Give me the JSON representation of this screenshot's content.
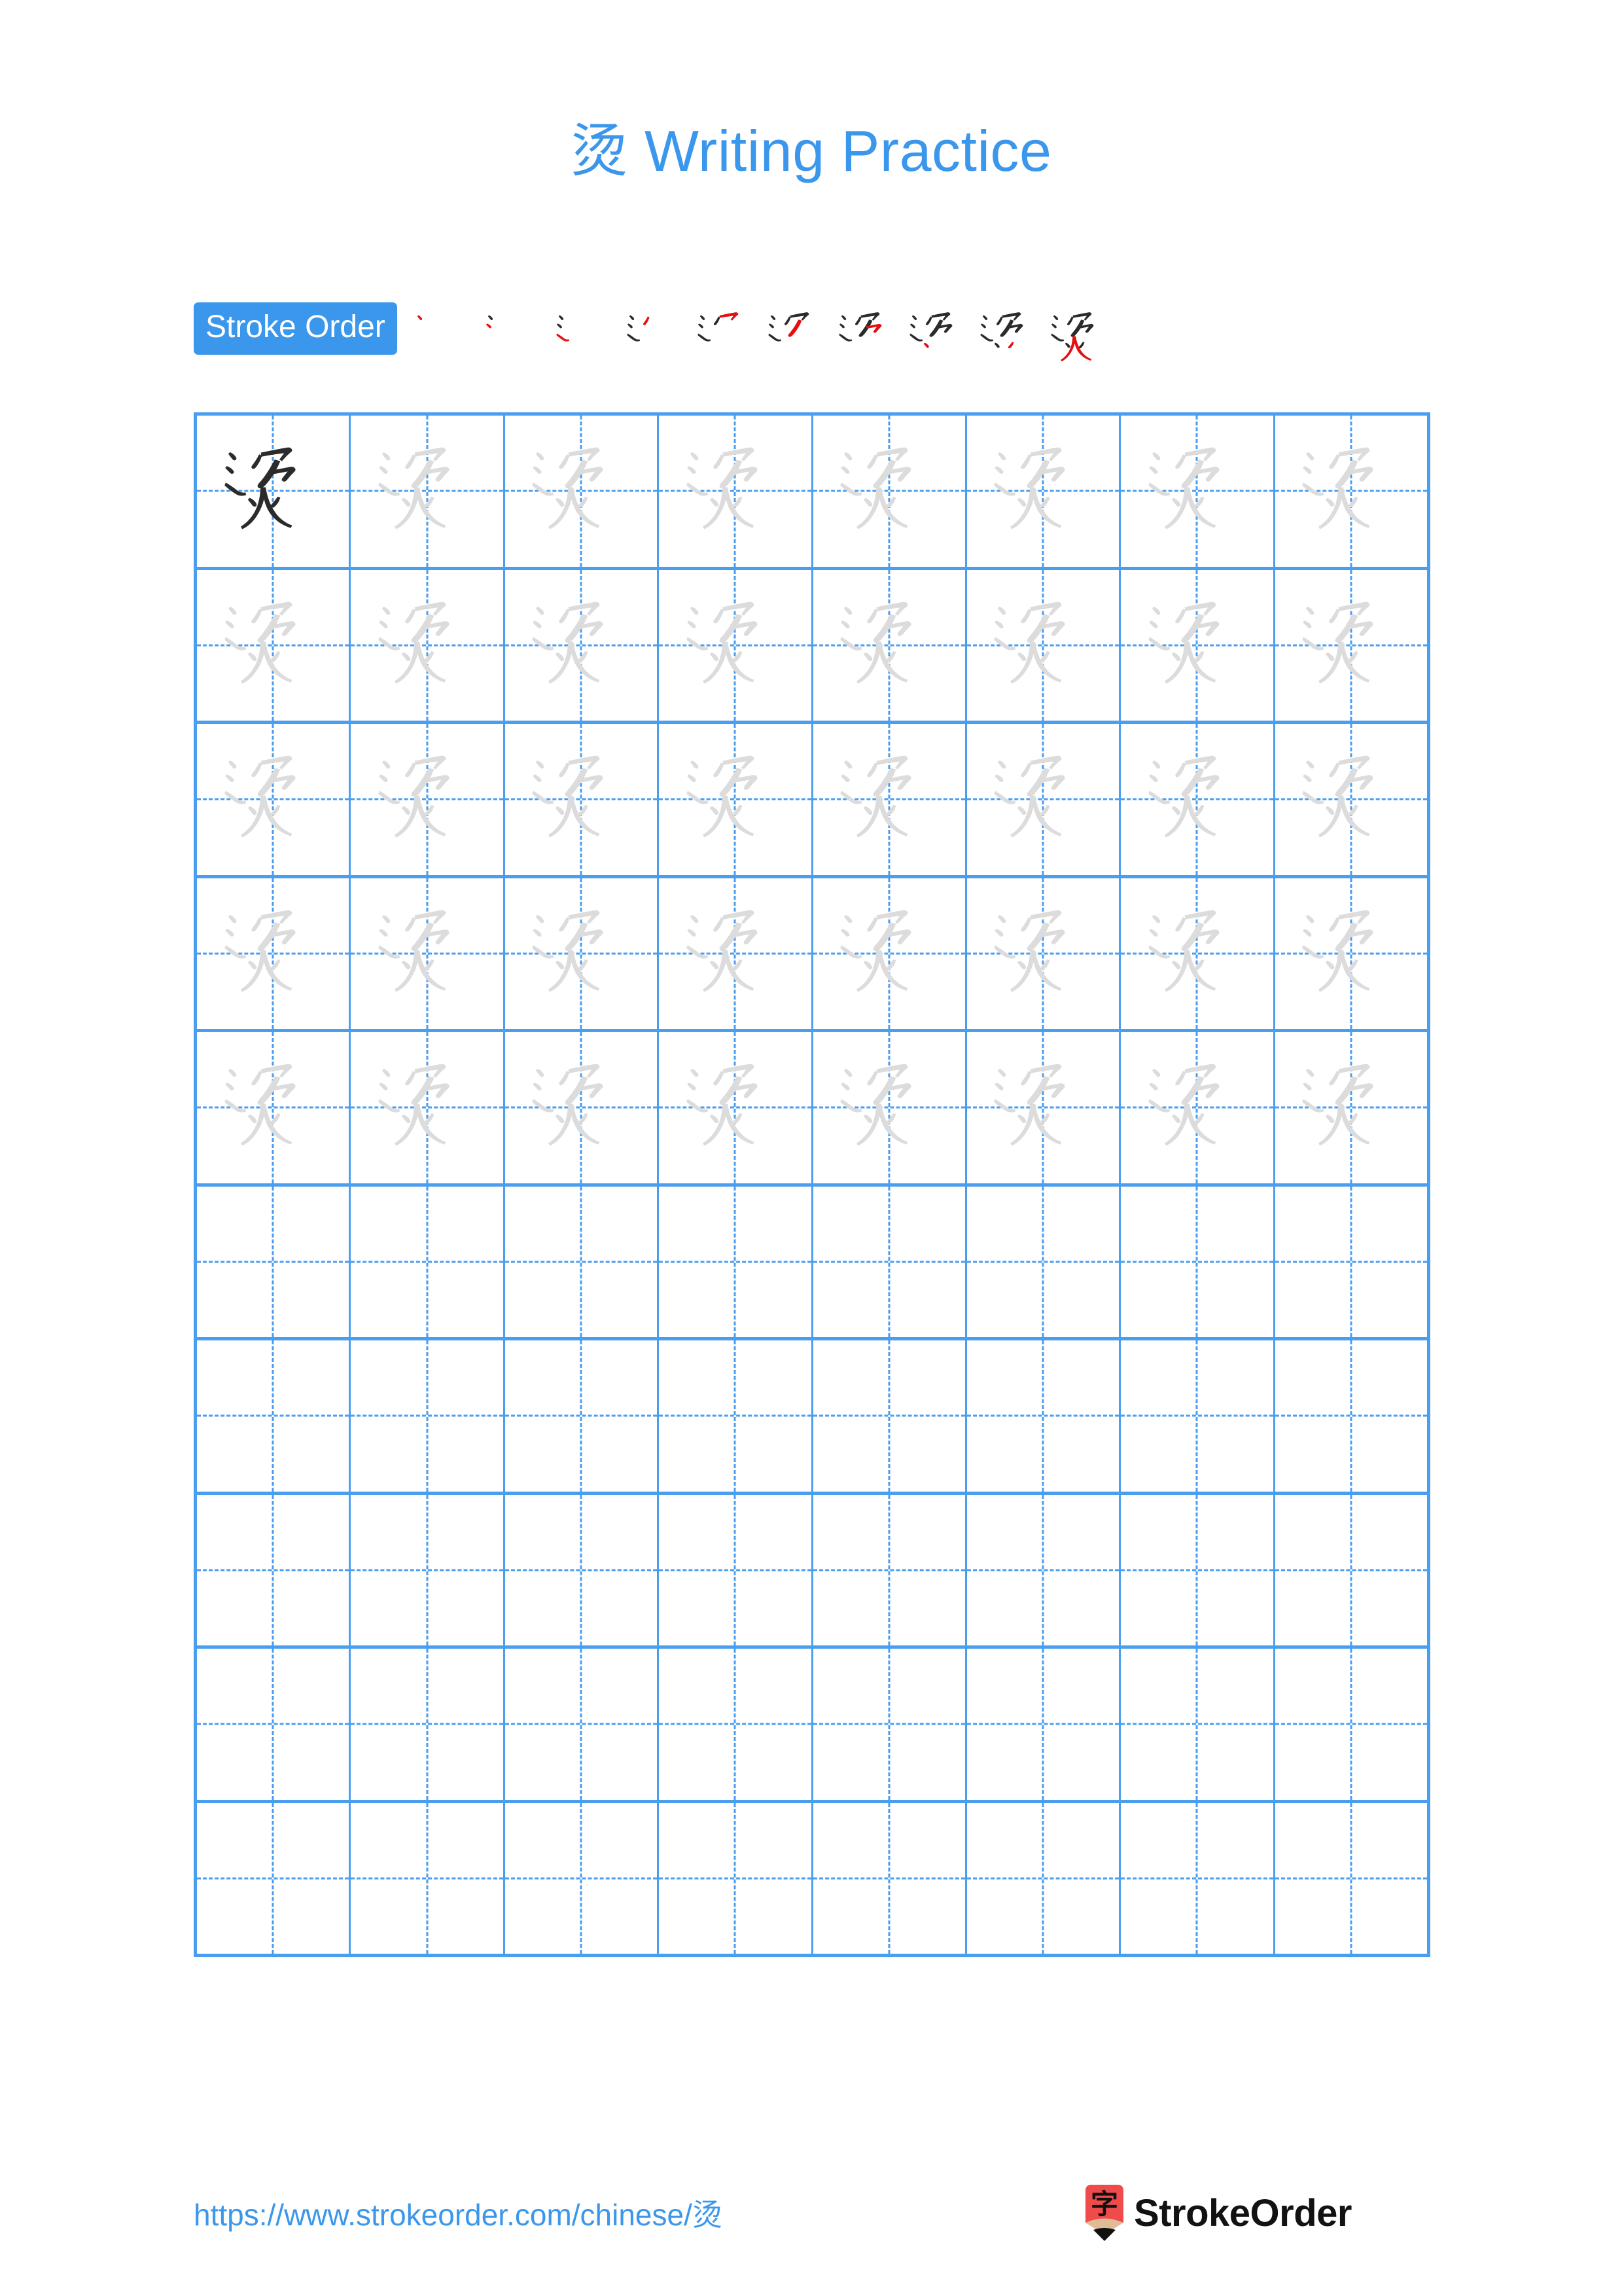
{
  "character": "烫",
  "title": {
    "character": "烫",
    "suffix": " Writing Practice",
    "color": "#3b97ec"
  },
  "stroke_order": {
    "label": "Stroke Order",
    "badge_bg": "#3b97ec",
    "badge_text_color": "#ffffff",
    "total_strokes": 10,
    "new_stroke_color": "#e60f0f",
    "done_stroke_color": "#2b2b2b",
    "steps": [
      {
        "index": 1,
        "strokes_shown": 1
      },
      {
        "index": 2,
        "strokes_shown": 2
      },
      {
        "index": 3,
        "strokes_shown": 3
      },
      {
        "index": 4,
        "strokes_shown": 4
      },
      {
        "index": 5,
        "strokes_shown": 5
      },
      {
        "index": 6,
        "strokes_shown": 6
      },
      {
        "index": 7,
        "strokes_shown": 7
      },
      {
        "index": 8,
        "strokes_shown": 8
      },
      {
        "index": 9,
        "strokes_shown": 9
      },
      {
        "index": 10,
        "strokes_shown": 10
      }
    ]
  },
  "grid": {
    "columns": 8,
    "rows": 10,
    "line_color": "#4a9ef0",
    "guide_color": "#4a9ef0",
    "model_glyph_color": "#2b2b2b",
    "trace_glyph_color": "#dcdcdc",
    "rows_data": [
      {
        "row": 1,
        "cells": [
          "model",
          "trace",
          "trace",
          "trace",
          "trace",
          "trace",
          "trace",
          "trace"
        ]
      },
      {
        "row": 2,
        "cells": [
          "trace",
          "trace",
          "trace",
          "trace",
          "trace",
          "trace",
          "trace",
          "trace"
        ]
      },
      {
        "row": 3,
        "cells": [
          "trace",
          "trace",
          "trace",
          "trace",
          "trace",
          "trace",
          "trace",
          "trace"
        ]
      },
      {
        "row": 4,
        "cells": [
          "trace",
          "trace",
          "trace",
          "trace",
          "trace",
          "trace",
          "trace",
          "trace"
        ]
      },
      {
        "row": 5,
        "cells": [
          "trace",
          "trace",
          "trace",
          "trace",
          "trace",
          "trace",
          "trace",
          "trace"
        ]
      },
      {
        "row": 6,
        "cells": [
          "empty",
          "empty",
          "empty",
          "empty",
          "empty",
          "empty",
          "empty",
          "empty"
        ]
      },
      {
        "row": 7,
        "cells": [
          "empty",
          "empty",
          "empty",
          "empty",
          "empty",
          "empty",
          "empty",
          "empty"
        ]
      },
      {
        "row": 8,
        "cells": [
          "empty",
          "empty",
          "empty",
          "empty",
          "empty",
          "empty",
          "empty",
          "empty"
        ]
      },
      {
        "row": 9,
        "cells": [
          "empty",
          "empty",
          "empty",
          "empty",
          "empty",
          "empty",
          "empty",
          "empty"
        ]
      },
      {
        "row": 10,
        "cells": [
          "empty",
          "empty",
          "empty",
          "empty",
          "empty",
          "empty",
          "empty",
          "empty"
        ]
      }
    ]
  },
  "footer": {
    "url_text": "https://www.strokeorder.com/chinese/",
    "url_character": "烫",
    "url_color": "#3b97ec",
    "brand_name": "StrokeOrder",
    "brand_mark_character": "字",
    "brand_mark_body_color": "#ef4b4b",
    "brand_mark_wood_color": "#e0bc96",
    "brand_mark_tip_color": "#111111"
  }
}
